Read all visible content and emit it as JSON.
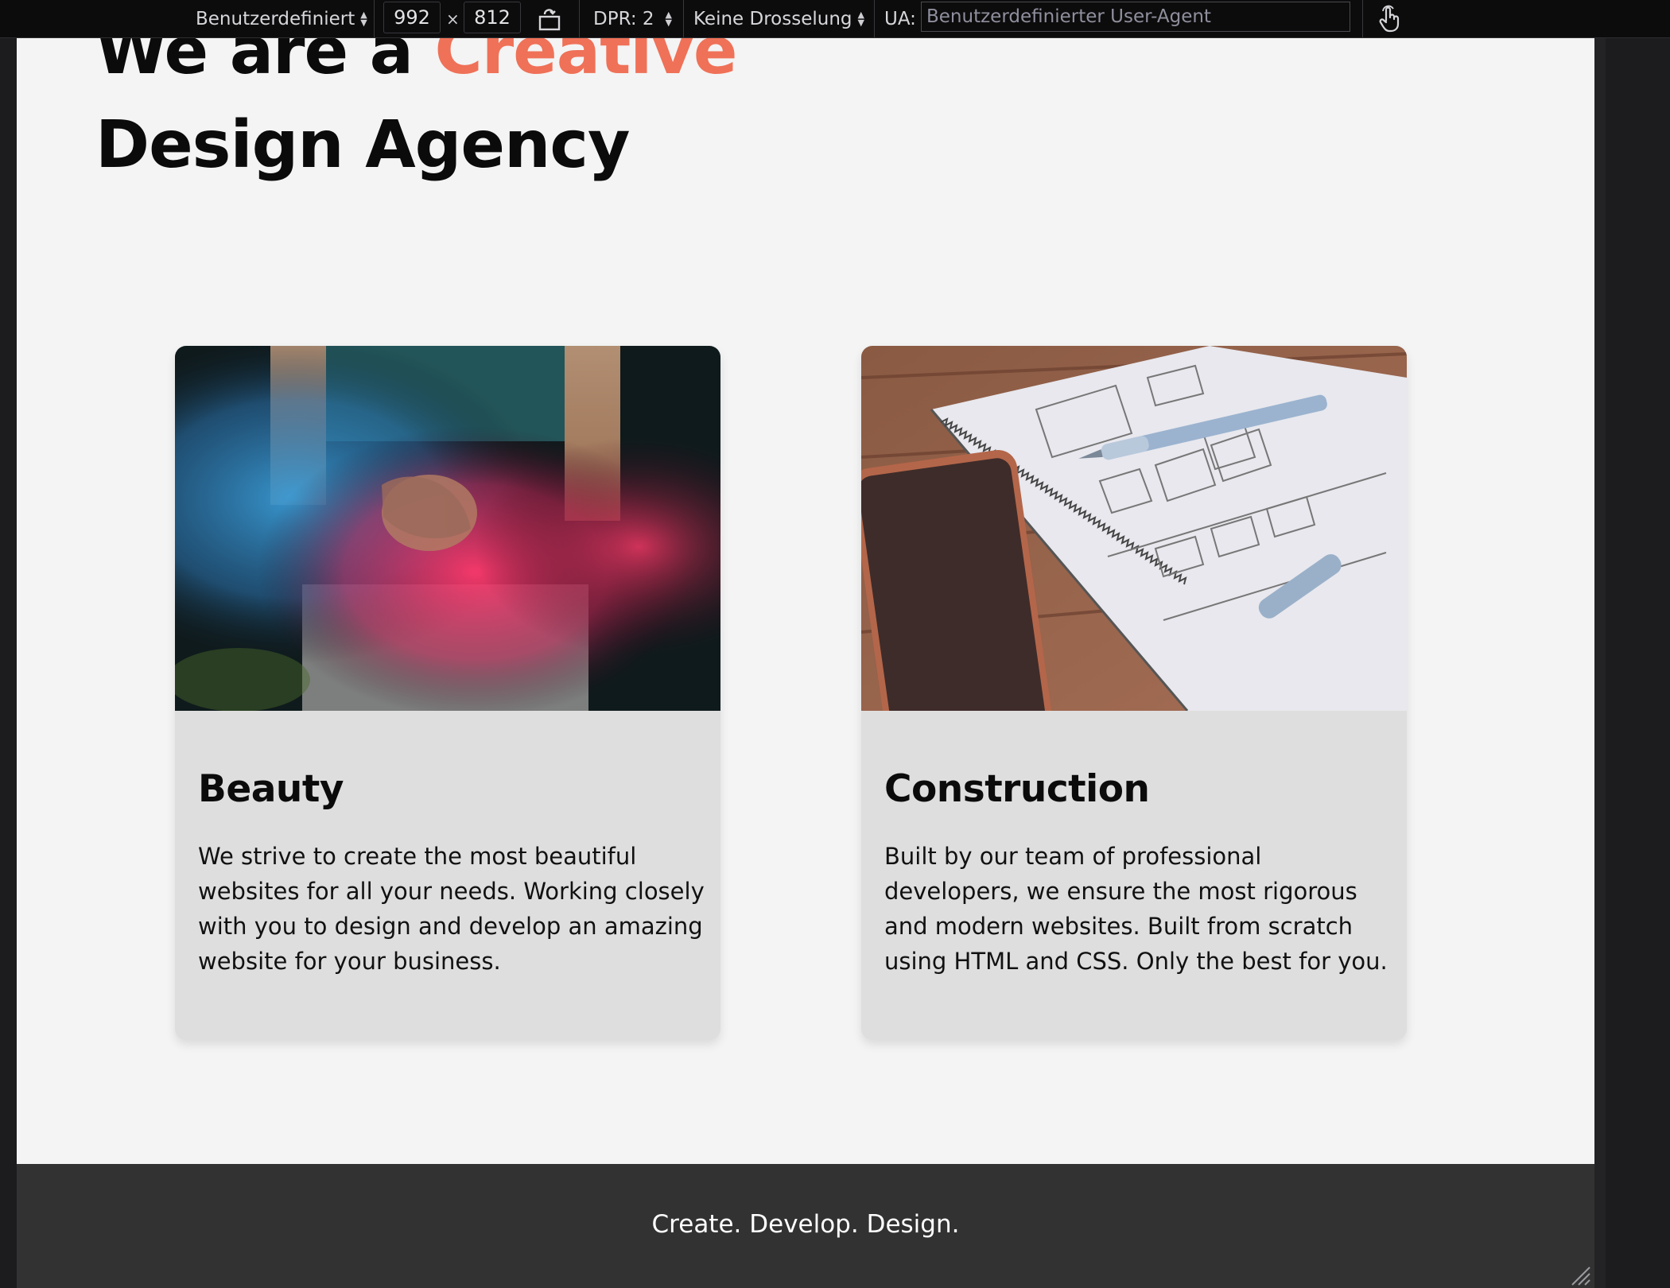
{
  "toolbar": {
    "device_preset": "Benutzerdefiniert",
    "width": "992",
    "times": "×",
    "height": "812",
    "dpr": "DPR: 2",
    "throttling": "Keine Drosselung",
    "ua_label": "UA:",
    "ua_placeholder": "Benutzerdefinierter User-Agent"
  },
  "hero": {
    "line1_prefix": "We are a ",
    "line1_accent": "Creative",
    "line2": "Design Agency"
  },
  "cards": [
    {
      "title": "Beauty",
      "text": "We strive to create the most beautiful websites for all your needs. Working closely with you to design and develop an amazing website for your business."
    },
    {
      "title": "Construction",
      "text": "Built by our team of professional developers, we ensure the most rigorous and modern websites. Built from scratch using HTML and CSS. Only the best for you."
    }
  ],
  "footer": {
    "tagline": "Create. Develop. Design."
  },
  "colors": {
    "accent": "#ef7158",
    "footer_bg": "#323232",
    "card_bg": "#dedede",
    "page_bg": "#f4f4f4"
  },
  "icons": [
    "rotate-device-icon",
    "touch-simulation-icon",
    "resize-grip-icon",
    "select-arrows-icon"
  ]
}
